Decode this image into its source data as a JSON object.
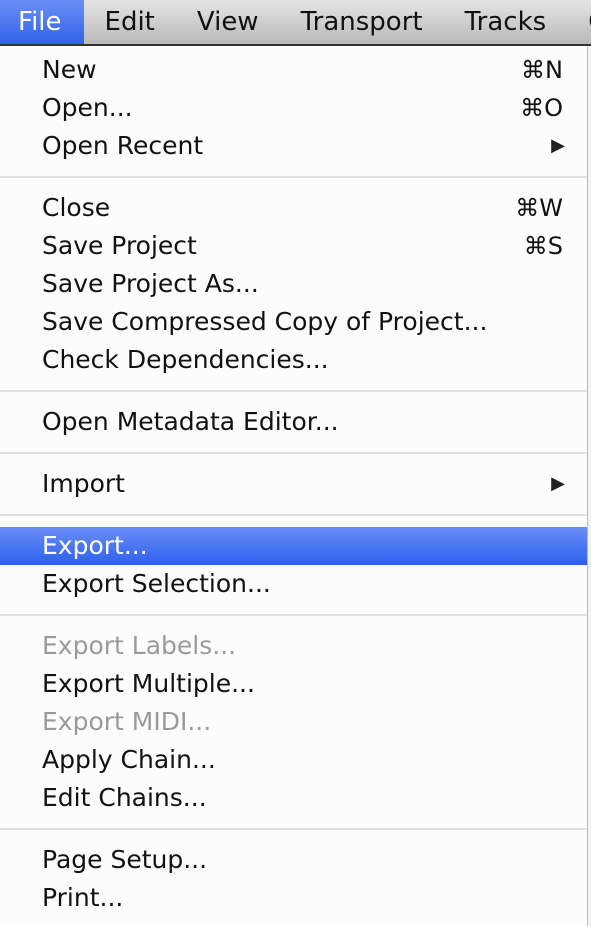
{
  "menubar": {
    "items": [
      "File",
      "Edit",
      "View",
      "Transport",
      "Tracks",
      "G"
    ],
    "active": "File"
  },
  "menu": {
    "groups": [
      [
        {
          "label": "New",
          "shortcut": "⌘N"
        },
        {
          "label": "Open...",
          "shortcut": "⌘O"
        },
        {
          "label": "Open Recent",
          "submenu": true
        }
      ],
      [
        {
          "label": "Close",
          "shortcut": "⌘W"
        },
        {
          "label": "Save Project",
          "shortcut": "⌘S"
        },
        {
          "label": "Save Project As..."
        },
        {
          "label": "Save Compressed Copy of Project..."
        },
        {
          "label": "Check Dependencies..."
        }
      ],
      [
        {
          "label": "Open Metadata Editor..."
        }
      ],
      [
        {
          "label": "Import",
          "submenu": true
        }
      ],
      [
        {
          "label": "Export...",
          "highlighted": true
        },
        {
          "label": "Export Selection..."
        }
      ],
      [
        {
          "label": "Export Labels...",
          "disabled": true
        },
        {
          "label": "Export Multiple..."
        },
        {
          "label": "Export MIDI...",
          "disabled": true
        },
        {
          "label": "Apply Chain..."
        },
        {
          "label": "Edit Chains..."
        }
      ],
      [
        {
          "label": "Page Setup..."
        },
        {
          "label": "Print..."
        }
      ]
    ],
    "submenu_arrow": "▶"
  },
  "colors": {
    "highlight": "#3b6cee"
  }
}
